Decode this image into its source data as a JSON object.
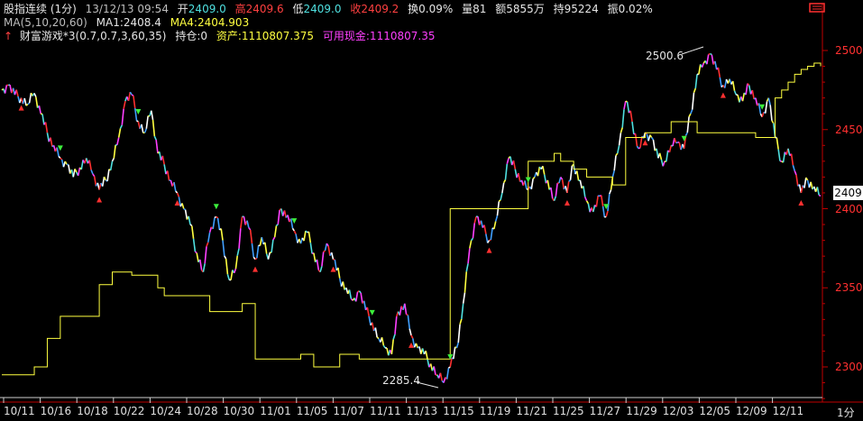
{
  "header": {
    "title": "股指连续 (1分)",
    "datetime": "13/12/13 09:54",
    "open_label": "开",
    "open_value": "2409.0",
    "high_label": "高",
    "high_value": "2409.6",
    "low_label": "低",
    "low_value": "2409.0",
    "close_label": "收",
    "close_value": "2409.2",
    "turnover": "换0.09%",
    "volume": "量81",
    "amount": "额5855万",
    "open_interest": "持95224",
    "amplitude": "振0.02%"
  },
  "ma_row": {
    "ma_title": "MA(5,10,20,60)",
    "ma1": "MA1:2408.4",
    "ma4": "MA4:2404.903"
  },
  "strategy_row": {
    "name": "财富游戏*3(0.7,0.7,3,60,35)",
    "position": "持仓:0",
    "assets": "资产:1110807.375",
    "cash": "可用现金:1110807.35"
  },
  "price_tag": "2409",
  "period": "1分",
  "annotations": {
    "max_label": "2500.6",
    "min_label": "2285.4"
  },
  "colors": {
    "background": "#000000",
    "axis": "#c00000",
    "price_up": "#ff3030",
    "price_down": "#4fe0e0",
    "ma_line": "#ffff40",
    "long_signal": "#ff3030",
    "short_signal": "#3cf03c"
  },
  "chart_data": {
    "type": "line",
    "title": "",
    "xlabel": "",
    "ylabel": "",
    "ylim": [
      2280,
      2510
    ],
    "yticks": [
      2300,
      2350,
      2400,
      2450,
      2500
    ],
    "x_dates": [
      "10/11",
      "10/16",
      "10/18",
      "10/22",
      "10/24",
      "10/28",
      "10/30",
      "11/01",
      "11/05",
      "11/07",
      "11/11",
      "11/13",
      "11/15",
      "11/19",
      "11/21",
      "11/25",
      "11/27",
      "11/29",
      "12/03",
      "12/05",
      "12/09",
      "12/11"
    ],
    "series": [
      {
        "values": [
          2475,
          2478,
          2472,
          2470,
          2466,
          2473,
          2460,
          2448,
          2440,
          2432,
          2428,
          2420,
          2426,
          2432,
          2422,
          2412,
          2418,
          2430,
          2445,
          2468,
          2472,
          2455,
          2448,
          2462,
          2435,
          2428,
          2418,
          2410,
          2400,
          2390,
          2372,
          2360,
          2385,
          2395,
          2380,
          2355,
          2362,
          2395,
          2388,
          2368,
          2382,
          2368,
          2382,
          2400,
          2396,
          2386,
          2378,
          2385,
          2372,
          2360,
          2378,
          2368,
          2356,
          2350,
          2342,
          2348,
          2336,
          2328,
          2318,
          2312,
          2308,
          2335,
          2340,
          2320,
          2312,
          2308,
          2302,
          2295,
          2290,
          2300,
          2312,
          2340,
          2375,
          2395,
          2388,
          2380,
          2392,
          2410,
          2432,
          2425,
          2418,
          2412,
          2420,
          2425,
          2418,
          2405,
          2420,
          2410,
          2428,
          2418,
          2405,
          2398,
          2408,
          2395,
          2420,
          2440,
          2468,
          2455,
          2438,
          2448,
          2445,
          2432,
          2430,
          2440,
          2442,
          2438,
          2460,
          2485,
          2492,
          2498,
          2488,
          2478,
          2482,
          2472,
          2468,
          2478,
          2470,
          2458,
          2470,
          2445,
          2430,
          2438,
          2424,
          2410,
          2418,
          2414,
          2408
        ]
      },
      {
        "values": [
          2295,
          2295,
          2295,
          2295,
          2295,
          2300,
          2300,
          2318,
          2318,
          2332,
          2332,
          2332,
          2332,
          2332,
          2332,
          2352,
          2352,
          2360,
          2360,
          2360,
          2358,
          2358,
          2358,
          2358,
          2350,
          2345,
          2345,
          2345,
          2345,
          2345,
          2345,
          2345,
          2335,
          2335,
          2335,
          2335,
          2335,
          2340,
          2340,
          2305,
          2305,
          2305,
          2305,
          2305,
          2305,
          2305,
          2308,
          2308,
          2300,
          2300,
          2300,
          2300,
          2308,
          2308,
          2308,
          2305,
          2305,
          2305,
          2305,
          2305,
          2305,
          2305,
          2305,
          2305,
          2305,
          2305,
          2305,
          2305,
          2305,
          2400,
          2400,
          2400,
          2400,
          2400,
          2400,
          2400,
          2400,
          2400,
          2400,
          2400,
          2400,
          2430,
          2430,
          2430,
          2430,
          2435,
          2430,
          2430,
          2425,
          2425,
          2420,
          2420,
          2420,
          2420,
          2415,
          2415,
          2445,
          2445,
          2445,
          2448,
          2448,
          2448,
          2448,
          2455,
          2455,
          2455,
          2455,
          2448,
          2448,
          2448,
          2448,
          2448,
          2448,
          2448,
          2448,
          2448,
          2445,
          2445,
          2445,
          2470,
          2475,
          2480,
          2485,
          2488,
          2490,
          2492,
          2490
        ]
      }
    ]
  }
}
